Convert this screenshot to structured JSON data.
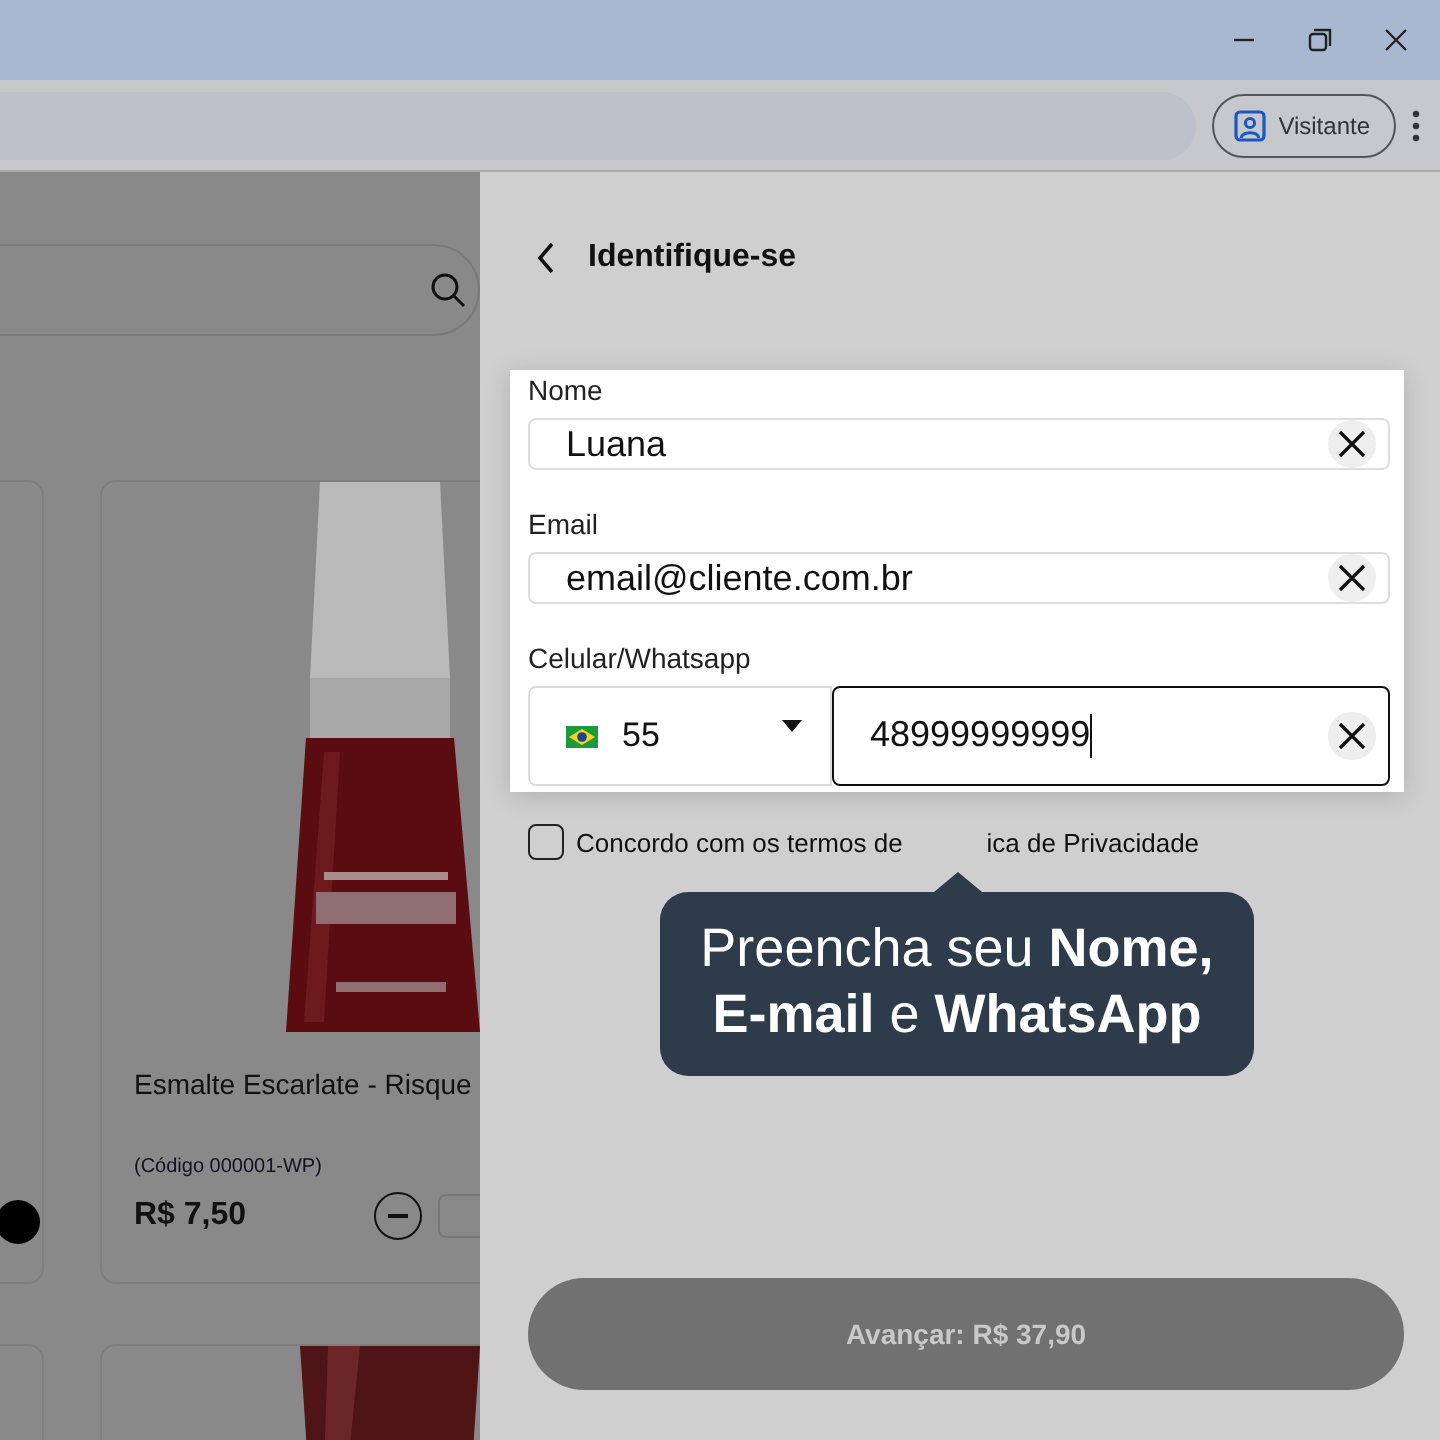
{
  "browser": {
    "profile_label": "Visitante"
  },
  "store": {
    "products": [
      {
        "name": "Esmalte Escarlate - Risque",
        "code": "(Código 000001-WP)",
        "price": "R$ 7,50",
        "kind": "picture"
      }
    ]
  },
  "panel": {
    "title": "Identifique-se",
    "fields": [
      {
        "label": "Nome",
        "value": "Luana",
        "kind": "text",
        "focused": false
      },
      {
        "label": "Email",
        "value": "email@cliente.com.br",
        "kind": "text",
        "focused": false
      },
      {
        "label": "Celular/Whatsapp",
        "kind": "phone",
        "country_code": "55",
        "value": "48999999999",
        "focused": true
      }
    ],
    "consent": {
      "text_parts": [
        "Concordo com os termos de",
        "ica de Privacidade"
      ],
      "checked": false
    },
    "tooltip": [
      "Preencha seu **Nome,**",
      "**E-mail** e **WhatsApp**"
    ],
    "submit": {
      "label": "Avançar: R$ 37,90",
      "disabled": true
    }
  }
}
